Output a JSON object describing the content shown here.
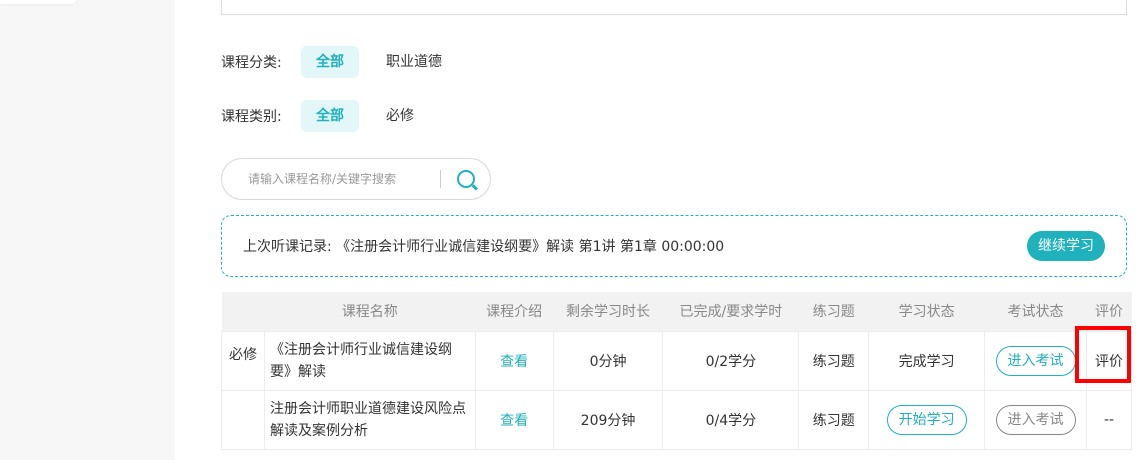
{
  "filters": [
    {
      "label": "课程分类:",
      "active": "全部",
      "options": [
        "职业道德"
      ]
    },
    {
      "label": "课程类别:",
      "active": "全部",
      "options": [
        "必修"
      ]
    }
  ],
  "search": {
    "placeholder": "请输入课程名称/关键字搜索"
  },
  "record": {
    "text": "上次听课记录: 《注册会计师行业诚信建设纲要》解读 第1讲 第1章 00:00:00",
    "button": "继续学习"
  },
  "table": {
    "headers": [
      "",
      "课程名称",
      "课程介绍",
      "剩余学习时长",
      "已完成/要求学时",
      "练习题",
      "学习状态",
      "考试状态",
      "评价"
    ],
    "rows": [
      {
        "type": "必修",
        "name": "《注册会计师行业诚信建设纲要》解读",
        "intro": "查看",
        "remaining": "0分钟",
        "progress": "0/2学分",
        "exercise": "练习题",
        "status": "完成学习",
        "exam": "进入考试",
        "rating": "评价"
      },
      {
        "type": "",
        "name": "注册会计师职业道德建设风险点解读及案例分析",
        "intro": "查看",
        "remaining": "209分钟",
        "progress": "0/4学分",
        "exercise": "练习题",
        "status": "开始学习",
        "exam": "进入考试",
        "rating": "--"
      }
    ]
  }
}
